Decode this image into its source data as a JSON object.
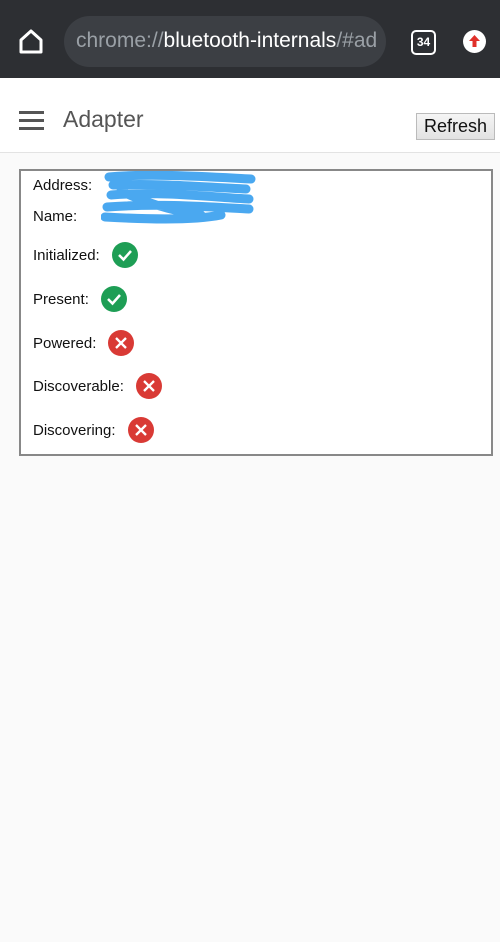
{
  "browser": {
    "url_scheme": "chrome://",
    "url_host": "bluetooth-internals",
    "url_rest": "/#ad",
    "tab_count": "34"
  },
  "appbar": {
    "title": "Adapter",
    "refresh_label": "Refresh"
  },
  "adapter": {
    "address_label": "Address:",
    "address_value": "",
    "name_label": "Name:",
    "name_value": "",
    "redaction_color": "#4aa8f0",
    "status": [
      {
        "label": "Initialized:",
        "value": true
      },
      {
        "label": "Present:",
        "value": true
      },
      {
        "label": "Powered:",
        "value": false
      },
      {
        "label": "Discoverable:",
        "value": false
      },
      {
        "label": "Discovering:",
        "value": false
      }
    ]
  }
}
